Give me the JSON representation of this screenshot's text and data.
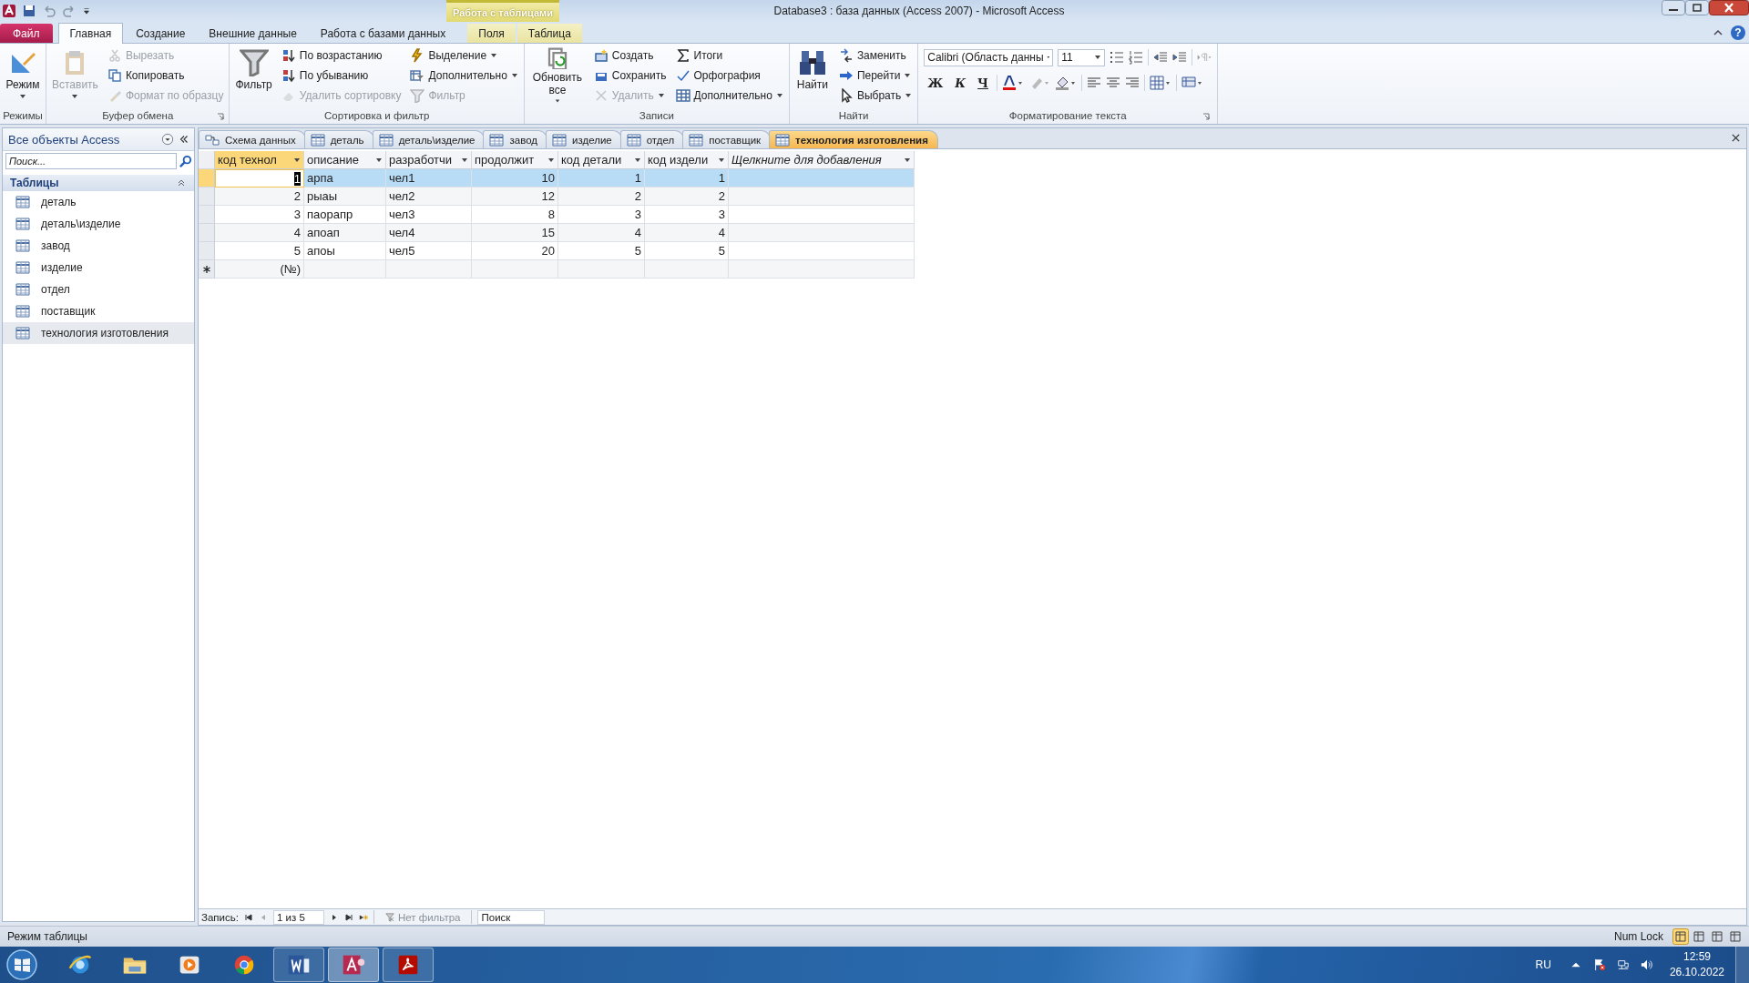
{
  "window": {
    "title": "Database3 : база данных (Access 2007)  -  Microsoft Access",
    "help_label": "?"
  },
  "contextual_group": {
    "label": "Работа с таблицами"
  },
  "ribbon_tabs": [
    {
      "label": "Файл",
      "kind": "file",
      "selected": false
    },
    {
      "label": "Главная",
      "kind": "normal",
      "selected": true
    },
    {
      "label": "Создание",
      "kind": "normal",
      "selected": false
    },
    {
      "label": "Внешние данные",
      "kind": "normal",
      "selected": false
    },
    {
      "label": "Работа с базами данных",
      "kind": "normal",
      "selected": false
    },
    {
      "label": "Поля",
      "kind": "contextual",
      "selected": false
    },
    {
      "label": "Таблица",
      "kind": "contextual",
      "selected": false
    }
  ],
  "ribbon_groups": [
    {
      "label": "Режимы",
      "launcher": false,
      "columns": [
        [
          {
            "label": "Режим",
            "kind": "large",
            "disabled": false,
            "dropdown": true
          }
        ]
      ]
    },
    {
      "label": "Буфер обмена",
      "launcher": true,
      "columns": [
        [
          {
            "label": "Вставить",
            "kind": "large",
            "disabled": true,
            "dropdown": true
          }
        ],
        [
          {
            "label": "Вырезать",
            "kind": "small",
            "disabled": true,
            "dropdown": false
          },
          {
            "label": "Копировать",
            "kind": "small",
            "disabled": false,
            "dropdown": false
          },
          {
            "label": "Формат по образцу",
            "kind": "small",
            "disabled": true,
            "dropdown": false
          }
        ]
      ]
    },
    {
      "label": "Сортировка и фильтр",
      "launcher": false,
      "columns": [
        [
          {
            "label": "Фильтр",
            "kind": "large",
            "disabled": false,
            "dropdown": false
          }
        ],
        [
          {
            "label": "По возрастанию",
            "kind": "small",
            "disabled": false,
            "dropdown": false
          },
          {
            "label": "По убыванию",
            "kind": "small",
            "disabled": false,
            "dropdown": false
          },
          {
            "label": "Удалить сортировку",
            "kind": "small",
            "disabled": true,
            "dropdown": false
          }
        ],
        [
          {
            "label": "Выделение",
            "kind": "small",
            "disabled": false,
            "dropdown": true
          },
          {
            "label": "Дополнительно",
            "kind": "small",
            "disabled": false,
            "dropdown": true
          },
          {
            "label": "Фильтр",
            "kind": "small",
            "disabled": true,
            "dropdown": false
          }
        ]
      ]
    },
    {
      "label": "Записи",
      "launcher": false,
      "columns": [
        [
          {
            "label": "Обновить все",
            "kind": "large",
            "disabled": false,
            "dropdown": true
          }
        ],
        [
          {
            "label": "Создать",
            "kind": "small",
            "disabled": false,
            "dropdown": false
          },
          {
            "label": "Сохранить",
            "kind": "small",
            "disabled": false,
            "dropdown": false
          },
          {
            "label": "Удалить",
            "kind": "small",
            "disabled": true,
            "dropdown": true
          }
        ],
        [
          {
            "label": "Итоги",
            "kind": "small",
            "disabled": false,
            "dropdown": false
          },
          {
            "label": "Орфография",
            "kind": "small",
            "disabled": false,
            "dropdown": false
          },
          {
            "label": "Дополнительно",
            "kind": "small",
            "disabled": false,
            "dropdown": true
          }
        ]
      ]
    },
    {
      "label": "Найти",
      "launcher": false,
      "columns": [
        [
          {
            "label": "Найти",
            "kind": "large",
            "disabled": false,
            "dropdown": false
          }
        ],
        [
          {
            "label": "Заменить",
            "kind": "small",
            "disabled": false,
            "dropdown": false
          },
          {
            "label": "Перейти",
            "kind": "small",
            "disabled": false,
            "dropdown": true
          },
          {
            "label": "Выбрать",
            "kind": "small",
            "disabled": false,
            "dropdown": true
          }
        ]
      ]
    }
  ],
  "format_group": {
    "label": "Форматирование текста",
    "font": "Calibri (Область данны",
    "size": "11",
    "styles": [
      {
        "label": "Ж",
        "kind": "bold"
      },
      {
        "label": "К",
        "kind": "italic"
      },
      {
        "label": "Ч",
        "kind": "underline"
      }
    ]
  },
  "nav_pane": {
    "title": "Все объекты Access",
    "search_placeholder": "Поиск...",
    "group": "Таблицы",
    "items": [
      {
        "label": "деталь",
        "selected": false
      },
      {
        "label": "деталь\\изделие",
        "selected": false
      },
      {
        "label": "завод",
        "selected": false
      },
      {
        "label": "изделие",
        "selected": false
      },
      {
        "label": "отдел",
        "selected": false
      },
      {
        "label": "поставщик",
        "selected": false
      },
      {
        "label": "технология изготовления",
        "selected": true
      }
    ]
  },
  "doc_tabs": [
    {
      "label": "Схема данных",
      "kind": "diagram",
      "selected": false
    },
    {
      "label": "деталь",
      "kind": "table",
      "selected": false
    },
    {
      "label": "деталь\\изделие",
      "kind": "table",
      "selected": false
    },
    {
      "label": "завод",
      "kind": "table",
      "selected": false
    },
    {
      "label": "изделие",
      "kind": "table",
      "selected": false
    },
    {
      "label": "отдел",
      "kind": "table",
      "selected": false
    },
    {
      "label": "поставщик",
      "kind": "table",
      "selected": false
    },
    {
      "label": "технология изготовления",
      "kind": "table",
      "selected": true
    }
  ],
  "table": {
    "columns": [
      {
        "label": "код технол",
        "kind": "number",
        "selected": true
      },
      {
        "label": "описание",
        "kind": "text",
        "selected": false
      },
      {
        "label": "разработчи",
        "kind": "text",
        "selected": false
      },
      {
        "label": "продолжит",
        "kind": "number",
        "selected": false
      },
      {
        "label": "код детали",
        "kind": "number",
        "selected": false
      },
      {
        "label": "код издели",
        "kind": "number",
        "selected": false
      },
      {
        "label": "Щелкните для добавления",
        "kind": "add",
        "selected": false
      }
    ],
    "rows": [
      {
        "cells": [
          "1",
          "арпа",
          "чел1",
          "10",
          "1",
          "1",
          ""
        ],
        "selected": true,
        "current": true
      },
      {
        "cells": [
          "2",
          "рыаы",
          "чел2",
          "12",
          "2",
          "2",
          ""
        ],
        "selected": false,
        "current": false
      },
      {
        "cells": [
          "3",
          "паорапр",
          "чел3",
          "8",
          "3",
          "3",
          ""
        ],
        "selected": false,
        "current": false
      },
      {
        "cells": [
          "4",
          "апоап",
          "чел4",
          "15",
          "4",
          "4",
          ""
        ],
        "selected": false,
        "current": false
      },
      {
        "cells": [
          "5",
          "апоы",
          "чел5",
          "20",
          "5",
          "5",
          ""
        ],
        "selected": false,
        "current": false
      }
    ],
    "new_row": {
      "placeholder": "(№)"
    }
  },
  "record_nav": {
    "label": "Запись:",
    "position": "1 из 5",
    "filter": "Нет фильтра",
    "search_placeholder": "Поиск"
  },
  "status_bar": {
    "mode": "Режим таблицы",
    "indicators": [
      "Num Lock"
    ],
    "views": [
      {
        "selected": true
      },
      {
        "selected": false
      },
      {
        "selected": false
      },
      {
        "selected": false
      }
    ]
  },
  "taskbar": {
    "apps": [
      {
        "kind": "ie",
        "running": false,
        "selected": false
      },
      {
        "kind": "explorer",
        "running": false,
        "selected": false
      },
      {
        "kind": "media",
        "running": false,
        "selected": false
      },
      {
        "kind": "chrome",
        "running": false,
        "selected": false
      },
      {
        "kind": "word",
        "running": true,
        "selected": false
      },
      {
        "kind": "access",
        "running": true,
        "selected": true
      },
      {
        "kind": "acrobat",
        "running": true,
        "selected": false
      }
    ],
    "language": "RU",
    "time": "12:59",
    "date": "26.10.2022"
  }
}
